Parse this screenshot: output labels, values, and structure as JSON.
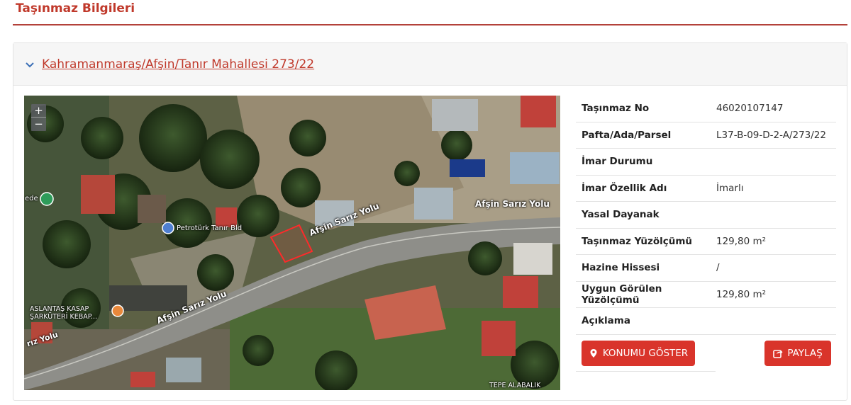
{
  "page": {
    "title": "Taşınmaz Bilgileri"
  },
  "panel": {
    "heading": "Kahramanmaraş/Afşin/Tanır Mahallesi 273/22"
  },
  "map": {
    "zoom_in": "+",
    "zoom_out": "−",
    "labels": {
      "road_top": "Afşin Sarız Yolu",
      "road_mid": "Afşin Sarız Yolu",
      "road_bottom": "Afşin Sarız Yolu",
      "road_left": "rız Yolu",
      "poi_petrol": "Petrotürk Tanır Bld",
      "poi_kasap_1": "ASLANTAŞ KASAP",
      "poi_kasap_2": "ŞARKÜTERİ KEBAP...",
      "poi_left": "ede",
      "bottom": "TEPE ALABALIK"
    }
  },
  "info": {
    "rows": [
      {
        "label": "Taşınmaz No",
        "value": "46020107147"
      },
      {
        "label": "Pafta/Ada/Parsel",
        "value": "L37-B-09-D-2-A/273/22"
      },
      {
        "label": "İmar Durumu",
        "value": ""
      },
      {
        "label": "İmar Özellik Adı",
        "value": "İmarlı"
      },
      {
        "label": "Yasal Dayanak",
        "value": ""
      },
      {
        "label": "Taşınmaz Yüzölçümü",
        "value": "129,80 m²"
      },
      {
        "label": "Hazine Hissesi",
        "value": "/"
      },
      {
        "label": "Uygun Görülen Yüzölçümü",
        "value": "129,80 m²"
      },
      {
        "label": "Açıklama",
        "value": ""
      }
    ],
    "buttons": {
      "show_location": "KONUMU GÖSTER",
      "share": "PAYLAŞ"
    }
  },
  "colors": {
    "accent": "#c0392b",
    "button": "#d9342b"
  }
}
